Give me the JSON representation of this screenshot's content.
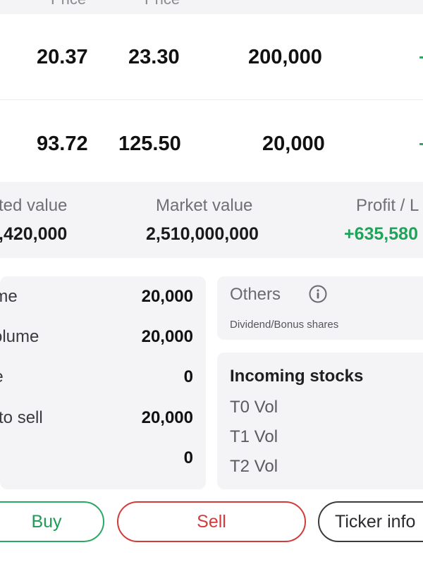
{
  "table": {
    "headers": [
      "Price",
      "Price"
    ],
    "rows": [
      {
        "avg_price": "20.37",
        "market_price": "23.30",
        "volume": "200,000",
        "trend": "+"
      },
      {
        "avg_price": "93.72",
        "market_price": "125.50",
        "volume": "20,000",
        "trend": "+"
      }
    ]
  },
  "summary": {
    "invested_label": "ted value",
    "invested_value": ",420,000",
    "market_label": "Market value",
    "market_value": "2,510,000,000",
    "profit_label": "Profit / L",
    "profit_value": "+635,580"
  },
  "volumes": [
    {
      "label": "ume",
      "value": "20,000"
    },
    {
      "label": "volume",
      "value": "20,000"
    },
    {
      "label": "ne",
      "value": "0"
    },
    {
      "label": "e to sell",
      "value": "20,000"
    },
    {
      "label": "",
      "value": "0"
    }
  ],
  "others": {
    "title": "Others",
    "subtitle": "Dividend/Bonus shares",
    "icon": "info-icon"
  },
  "incoming": {
    "title": "Incoming stocks",
    "items": [
      "T0 Vol",
      "T1 Vol",
      "T2 Vol"
    ]
  },
  "buttons": {
    "buy": "Buy",
    "sell": "Sell",
    "ticker": "Ticker info"
  },
  "colors": {
    "positive": "#1fa45a",
    "negative": "#d23b3b",
    "card_bg": "#f4f4f6"
  }
}
